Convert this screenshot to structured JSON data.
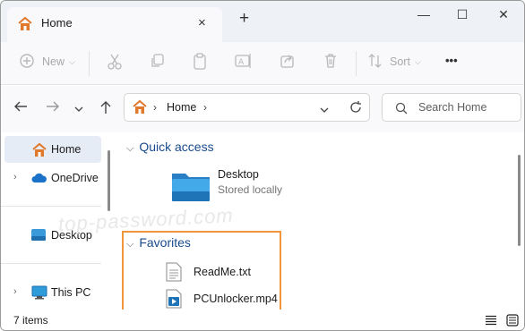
{
  "window": {
    "tab_title": "Home",
    "tab_close": "×",
    "new_tab": "+",
    "minimize": "—",
    "maximize": "☐",
    "close": "✕"
  },
  "toolbar": {
    "new_label": "New",
    "sort_label": "Sort",
    "more_label": "•••"
  },
  "address": {
    "crumb": "Home",
    "search_placeholder": "Search Home"
  },
  "sidebar": {
    "items": [
      {
        "label": "Home",
        "selected": true,
        "chevron": false,
        "icon": "home-icon"
      },
      {
        "label": "OneDrive",
        "selected": false,
        "chevron": true,
        "icon": "cloud-icon"
      },
      {
        "label": "Desktop",
        "selected": false,
        "chevron": false,
        "icon": "desktop-icon"
      },
      {
        "label": "This PC",
        "selected": false,
        "chevron": true,
        "icon": "pc-icon"
      }
    ]
  },
  "main": {
    "quick_access": {
      "heading": "Quick access",
      "items": [
        {
          "name": "Desktop",
          "sub": "Stored locally",
          "icon": "folder-icon"
        }
      ]
    },
    "favorites": {
      "heading": "Favorites",
      "items": [
        {
          "name": "ReadMe.txt",
          "icon": "text-file-icon"
        },
        {
          "name": "PCUnlocker.mp4",
          "icon": "video-file-icon"
        }
      ]
    },
    "watermark": "top-password.com"
  },
  "status": {
    "item_count": "7 items"
  },
  "colors": {
    "accent": "#0067c0",
    "highlight_border": "#f0963c",
    "heading": "#1a4b8e",
    "selection": "#e6ecf5"
  }
}
